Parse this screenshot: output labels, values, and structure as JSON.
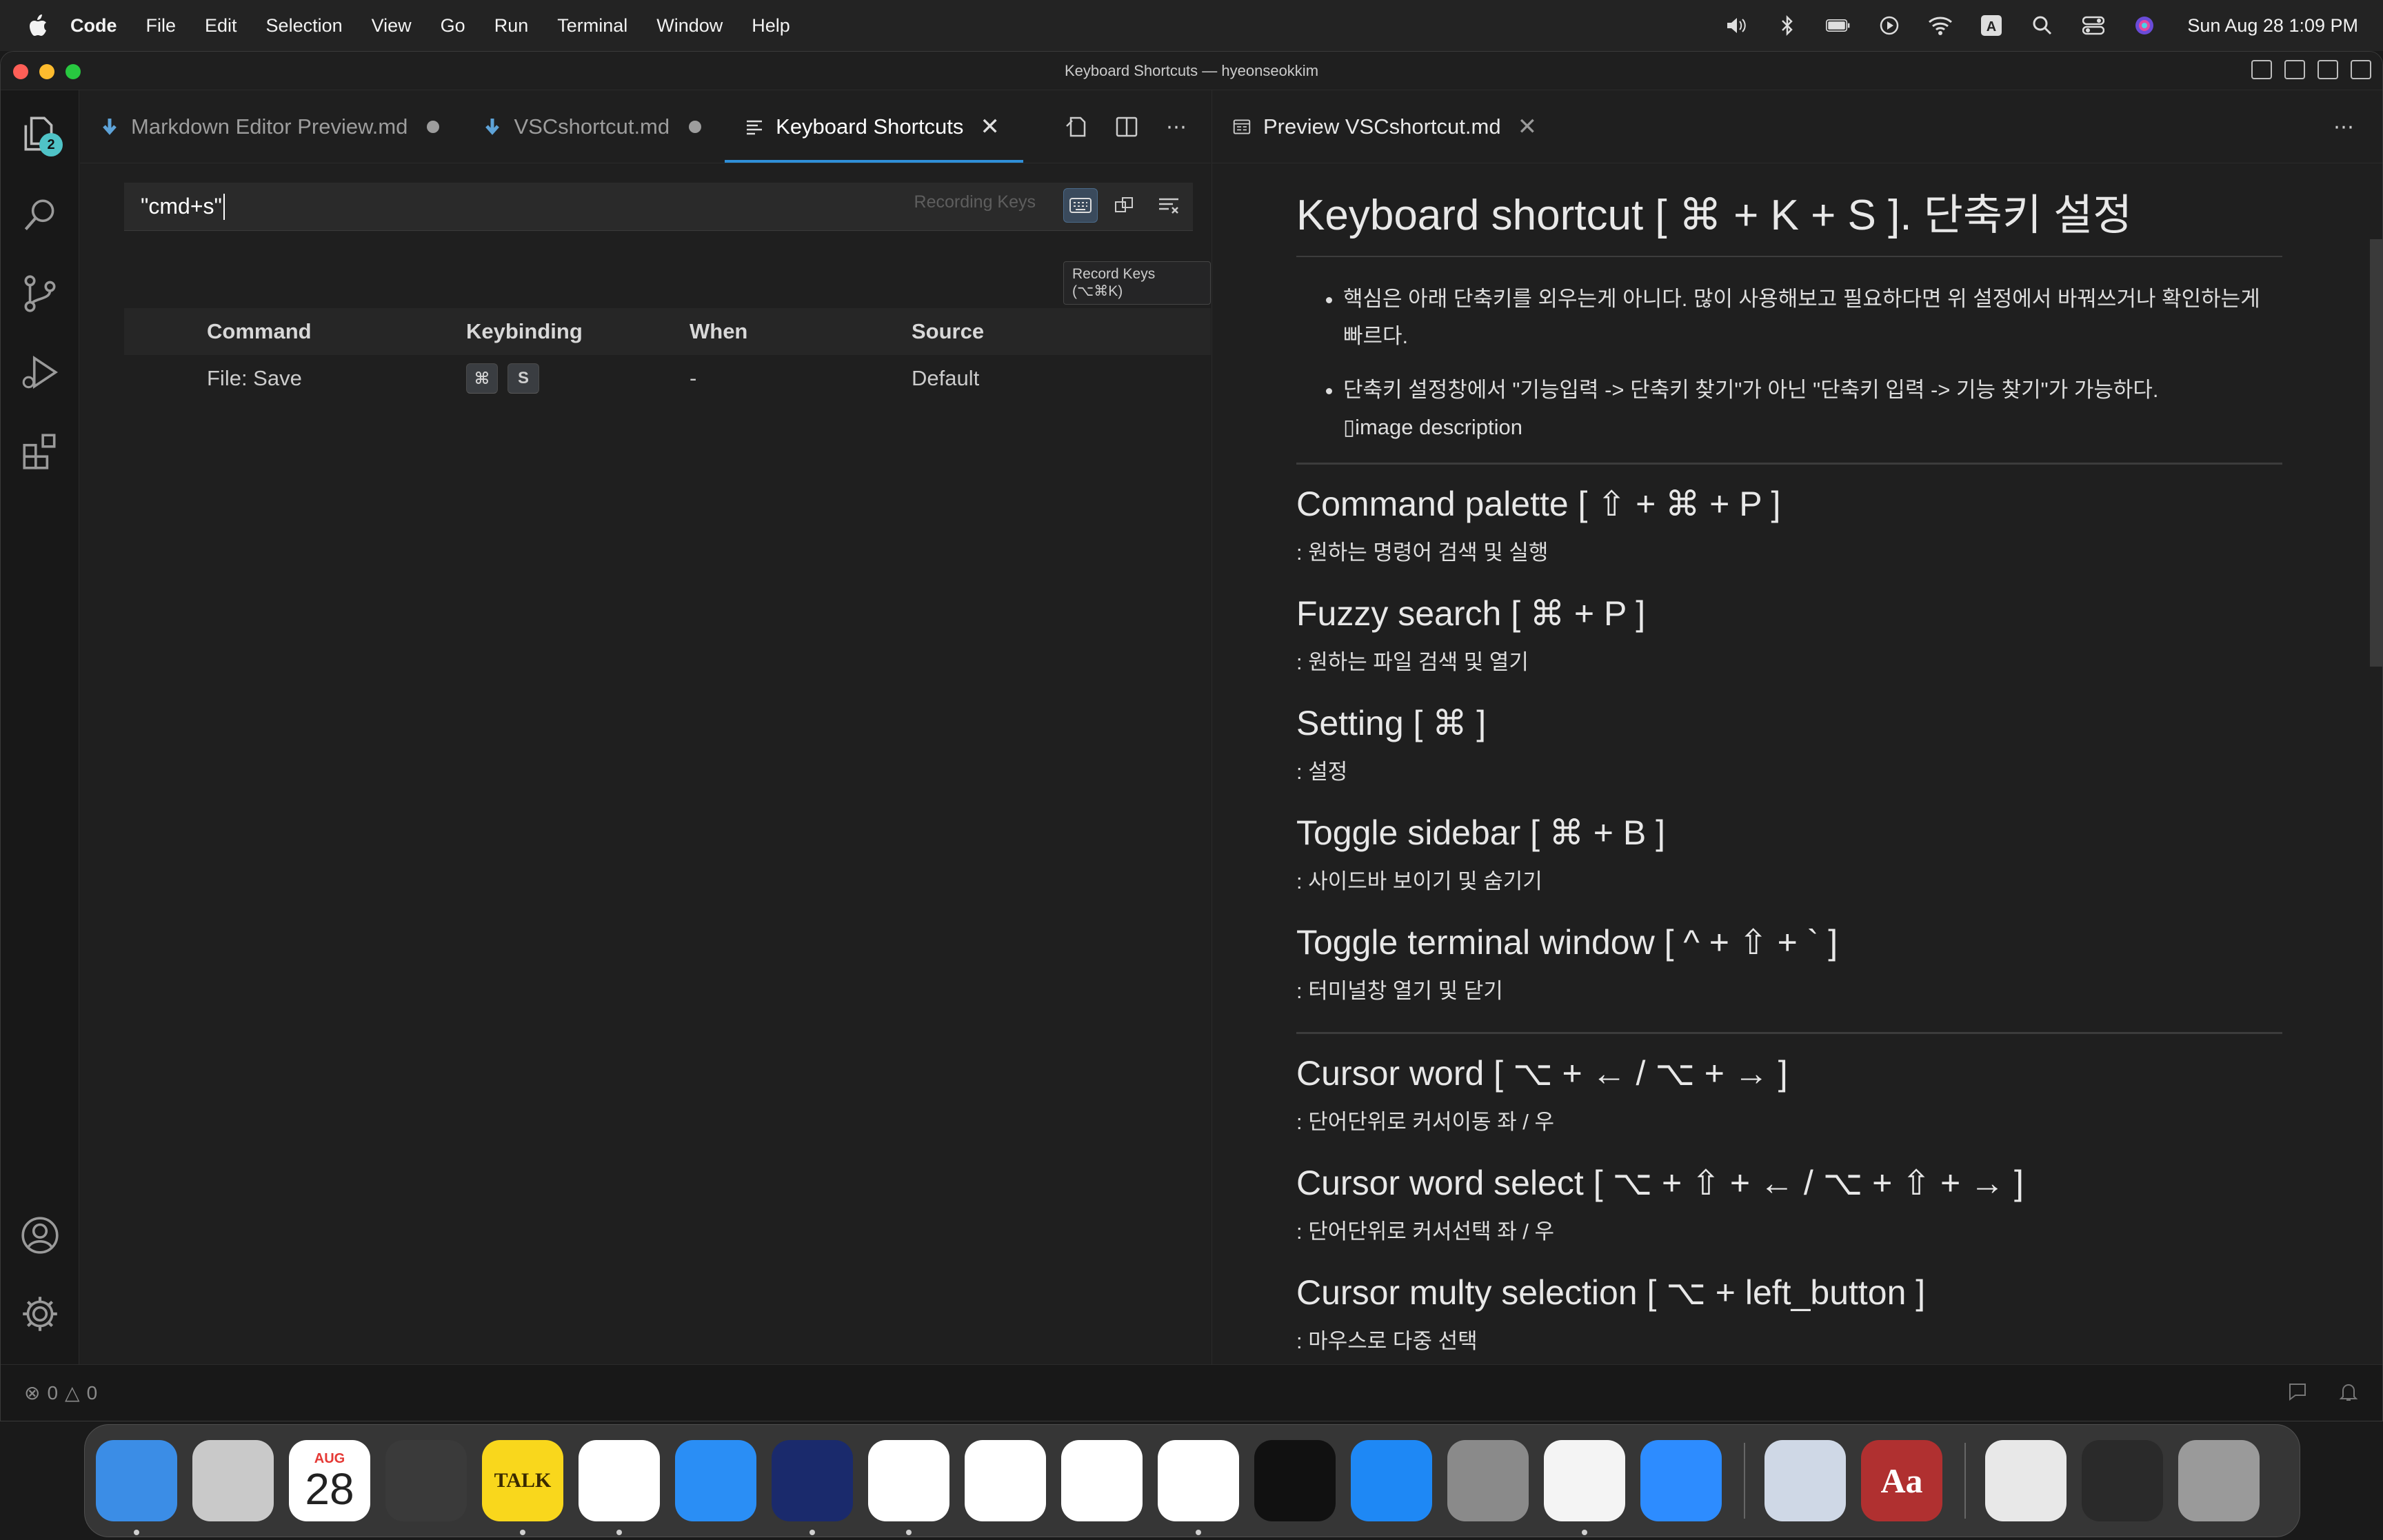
{
  "menubar": {
    "app": "Code",
    "items": [
      "File",
      "Edit",
      "Selection",
      "View",
      "Go",
      "Run",
      "Terminal",
      "Window",
      "Help"
    ],
    "clock": "Sun Aug 28  1:09 PM",
    "status_icons": [
      "volume-icon",
      "bluetooth-icon",
      "battery-icon",
      "play-icon",
      "wifi-icon",
      "input-source-icon",
      "spotlight-icon",
      "control-center-icon",
      "siri-icon"
    ]
  },
  "window": {
    "title": "Keyboard Shortcuts — hyeonseokkim"
  },
  "activitybar": {
    "explorer_badge": "2"
  },
  "editor1": {
    "tabs": [
      {
        "label": "Markdown Editor Preview.md",
        "icon": "markdown-icon",
        "dirty": true
      },
      {
        "label": "VSCshortcut.md",
        "icon": "markdown-icon",
        "dirty": true
      },
      {
        "label": "Keyboard Shortcuts",
        "icon": "list-icon",
        "active": true
      }
    ],
    "search": {
      "value": "\"cmd+s\"",
      "recording_label": "Recording Keys",
      "tooltip": "Record Keys (⌥⌘K)"
    },
    "table": {
      "headers": {
        "command": "Command",
        "keybinding": "Keybinding",
        "when": "When",
        "source": "Source"
      },
      "rows": [
        {
          "command": "File: Save",
          "keys": [
            "⌘",
            "S"
          ],
          "when": "-",
          "source": "Default"
        }
      ]
    }
  },
  "editor2": {
    "tab": {
      "label": "Preview VSCshortcut.md",
      "icon": "preview-icon"
    },
    "preview": {
      "h1": "Keyboard shortcut [ ⌘ + K + S ]. 단축키 설정",
      "bullets": [
        "핵심은 아래 단축키를 외우는게 아니다. 많이 사용해보고 필요하다면 위 설정에서 바꿔쓰거나 확인하는게 빠르다.",
        "단축키 설정창에서 \"기능입력 -> 단축키 찾기\"가 아닌 \"단축키 입력 -> 기능 찾기\"가 가능하다."
      ],
      "image_alt": "image description",
      "sections_a": [
        {
          "title": "Command palette [ ⇧ + ⌘ + P ]",
          "desc": ": 원하는 명령어 검색 및 실행"
        },
        {
          "title": "Fuzzy search [ ⌘ + P ]",
          "desc": ": 원하는 파일 검색 및 열기"
        },
        {
          "title": "Setting [ ⌘ ]",
          "desc": ": 설정"
        },
        {
          "title": "Toggle sidebar [ ⌘ + B ]",
          "desc": ": 사이드바 보이기 및 숨기기"
        },
        {
          "title": "Toggle terminal window [ ^ + ⇧ + ` ]",
          "desc": ": 터미널창 열기 및 닫기"
        }
      ],
      "sections_b": [
        {
          "title": "Cursor word [ ⌥ + ← / ⌥ + → ]",
          "desc": ": 단어단위로 커서이동 좌 / 우"
        },
        {
          "title": "Cursor word select [ ⌥ + ⇧ + ← / ⌥ + ⇧ + → ]",
          "desc": ": 단어단위로 커서선택 좌 / 우"
        },
        {
          "title": "Cursor multy selection [ ⌥ + left_button ]",
          "desc": ": 마우스로 다중 선택"
        }
      ]
    }
  },
  "statusbar": {
    "errors": "0",
    "warnings": "0"
  },
  "dock": {
    "apps": [
      {
        "name": "finder-icon",
        "color": "#3b8de6"
      },
      {
        "name": "launchpad-icon",
        "color": "#c9c9c9"
      },
      {
        "name": "calendar-icon",
        "color": "#ffffff",
        "month": "AUG",
        "day": "28"
      },
      {
        "name": "calculator-icon",
        "color": "#3a3a3a"
      },
      {
        "name": "kakaotalk-icon",
        "color": "#f9d71c",
        "text": "TALK"
      },
      {
        "name": "todo-icon",
        "color": "#ffffff"
      },
      {
        "name": "safari-icon",
        "color": "#2a8ef5"
      },
      {
        "name": "whale-icon",
        "color": "#1a2a6c"
      },
      {
        "name": "chrome-icon",
        "color": "#ffffff"
      },
      {
        "name": "photos-icon",
        "color": "#ffffff"
      },
      {
        "name": "onedrive-icon",
        "color": "#ffffff"
      },
      {
        "name": "vscode-icon",
        "color": "#ffffff"
      },
      {
        "name": "terminal-icon",
        "color": "#111111"
      },
      {
        "name": "app-store-icon",
        "color": "#1e88f5"
      },
      {
        "name": "system-preferences-icon",
        "color": "#8a8a8a"
      },
      {
        "name": "textedit-icon",
        "color": "#f4f4f4"
      },
      {
        "name": "zoom-icon",
        "color": "#2d8cff"
      }
    ],
    "apps_right": [
      {
        "name": "preview-app-icon",
        "color": "#cfd8e6"
      },
      {
        "name": "dictionary-icon",
        "color": "#b03030",
        "text": "Aa"
      }
    ],
    "apps_trash": [
      {
        "name": "downloads-folder-icon",
        "color": "#e8e8e8"
      },
      {
        "name": "recent-app-icon",
        "color": "#2a2a2a"
      },
      {
        "name": "trash-icon",
        "color": "#9a9a9a"
      }
    ]
  }
}
